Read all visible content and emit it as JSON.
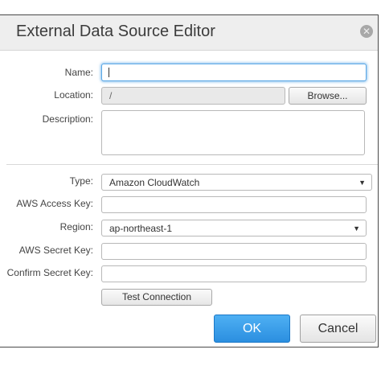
{
  "dialog": {
    "title": "External Data Source Editor",
    "close_icon": "close-icon"
  },
  "form": {
    "name_label": "Name:",
    "name_value": "",
    "location_label": "Location:",
    "location_value": "/",
    "browse_label": "Browse...",
    "description_label": "Description:",
    "description_value": "",
    "type_label": "Type:",
    "type_value": "Amazon CloudWatch",
    "access_key_label": "AWS Access Key:",
    "access_key_value": "",
    "region_label": "Region:",
    "region_value": "ap-northeast-1",
    "secret_key_label": "AWS Secret Key:",
    "secret_key_value": "",
    "confirm_secret_label": "Confirm Secret Key:",
    "confirm_secret_value": "",
    "test_connection_label": "Test Connection"
  },
  "footer": {
    "ok_label": "OK",
    "cancel_label": "Cancel"
  },
  "colors": {
    "accent": "#2b8fe0",
    "focus": "#5aa7e6",
    "title_bar": "#eeeeee"
  }
}
